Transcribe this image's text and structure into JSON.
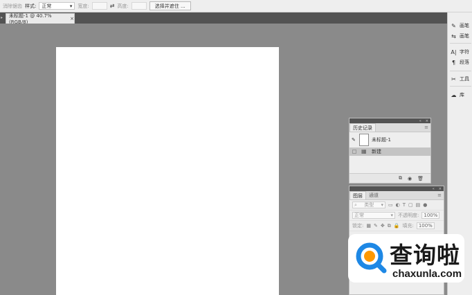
{
  "options_bar": {
    "feather_label": "消除锯齿",
    "style_label": "样式:",
    "style_value": "正常",
    "width_label": "宽度:",
    "height_label": "高度:",
    "select_subject_button": "选择并遮住 ..."
  },
  "document_tab": {
    "title": "未标题-1 @ 40.7%(RGB/8)",
    "close": "×"
  },
  "right_dock": {
    "items": [
      {
        "label": "画笔",
        "icon": "brush-icon"
      },
      {
        "label": "画笔",
        "icon": "brush-settings-icon"
      },
      {
        "label": "字符",
        "icon": "character-icon"
      },
      {
        "label": "段落",
        "icon": "paragraph-icon"
      },
      {
        "label": "工具",
        "icon": "tools-icon"
      },
      {
        "label": "库",
        "icon": "library-icon"
      }
    ]
  },
  "history_panel": {
    "tab": "历史记录",
    "rows": [
      {
        "label": "未标题-1"
      },
      {
        "label": "新建"
      }
    ]
  },
  "layers_panel": {
    "tabs": [
      "图层",
      "通道"
    ],
    "filter_label": "类型",
    "blend_mode": "正常",
    "opacity_label": "不透明度:",
    "opacity_value": "100%",
    "lock_label": "锁定:",
    "fill_label": "填充:",
    "fill_value": "100%"
  },
  "watermark": {
    "text_cn": "查询啦",
    "url": "chaxunla.com"
  },
  "colors": {
    "canvas_bg": "#8a8a8a",
    "panel_bg": "#eeeeee",
    "watermark_blue": "#1e88e5",
    "watermark_orange": "#ff9800"
  }
}
